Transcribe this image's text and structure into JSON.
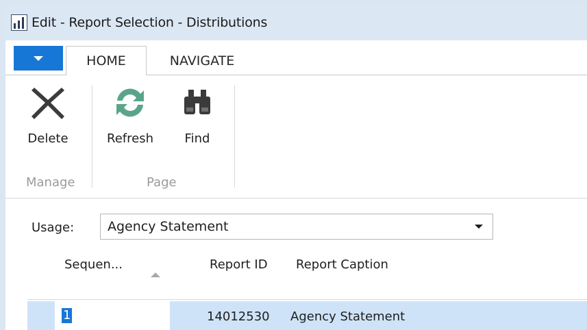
{
  "window": {
    "title": "Edit - Report Selection - Distributions"
  },
  "tabs": {
    "home": "HOME",
    "navigate": "NAVIGATE"
  },
  "ribbon": {
    "delete_label": "Delete",
    "refresh_label": "Refresh",
    "find_label": "Find",
    "group_manage": "Manage",
    "group_page": "Page"
  },
  "icons": {
    "app": "app-chart-icon",
    "delete": "delete-x-icon",
    "refresh": "refresh-icon",
    "find": "binoculars-icon",
    "menu": "caret-down-icon"
  },
  "colors": {
    "accent": "#1777d6",
    "refresh_green": "#5aa58a",
    "selection": "#cfe3f8",
    "titlebar": "#dce7f4"
  },
  "usage": {
    "label": "Usage:",
    "value": "Agency Statement"
  },
  "grid": {
    "columns": [
      "Sequen...",
      "Report ID",
      "Report Caption"
    ],
    "rows": [
      {
        "sequence": "1",
        "report_id": "14012530",
        "report_caption": "Agency Statement"
      }
    ]
  }
}
